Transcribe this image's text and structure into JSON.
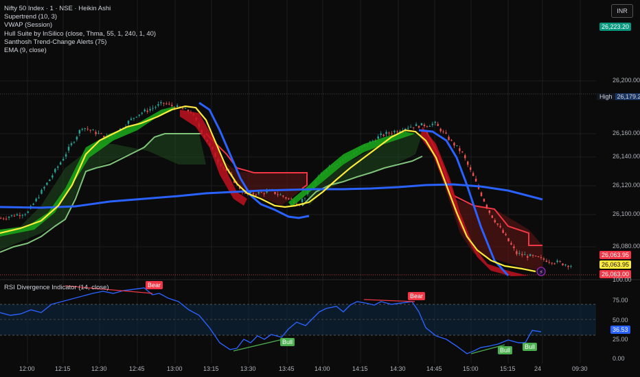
{
  "legend": {
    "symbol": "Nifty 50 Index · 1 · NSE · Heikin Ashi",
    "ind1": "Supertrend (10, 3)",
    "ind2": "VWAP (Session)",
    "ind3": "Hull Suite by InSilico (close, Thma, 55, 1, 240, 1, 40)",
    "ind4": "Santhosh Trend-Change Alerts (75)",
    "ind5": "EMA (9, close)"
  },
  "currency": "INR",
  "price_axis": {
    "ticks": [
      "26,200.00",
      "26,160.00",
      "26,140.00",
      "26,120.00",
      "26,100.00",
      "26,080.00"
    ],
    "high_label": "High",
    "high_value": "26,179.20",
    "top_tag": "26,223.20",
    "tags": [
      "26,063.95",
      "26,063.95",
      "26,063.00"
    ]
  },
  "rsi": {
    "label": "RSI Divergence Indicator (14, close)",
    "ticks": [
      "100.00",
      "75.00",
      "50.00",
      "25.00",
      "0.00"
    ],
    "current": "36.53",
    "signals": [
      "Bear",
      "Bear",
      "Bull",
      "Bull",
      "Bull"
    ]
  },
  "time_axis": [
    "12:00",
    "12:15",
    "12:30",
    "12:45",
    "13:00",
    "13:15",
    "13:30",
    "13:45",
    "14:00",
    "14:15",
    "14:30",
    "14:45",
    "15:00",
    "15:15",
    "24",
    "09:30"
  ],
  "colors": {
    "background": "#0b0b0b",
    "bull": "#26a69a",
    "bear": "#ef5350",
    "vwap": "#2962ff",
    "ema": "#ffeb3b",
    "supertrend_up": "#4caf50",
    "supertrend_down": "#f23645",
    "rsi": "#2962ff"
  },
  "chart_data": {
    "type": "candlestick",
    "x_range": [
      "11:55",
      "15:30"
    ],
    "y_range": [
      26058,
      26230
    ],
    "approx_close_path": [
      {
        "t": "11:55",
        "v": 26096
      },
      {
        "t": "12:05",
        "v": 26100
      },
      {
        "t": "12:15",
        "v": 26128
      },
      {
        "t": "12:25",
        "v": 26158
      },
      {
        "t": "12:35",
        "v": 26150
      },
      {
        "t": "12:45",
        "v": 26166
      },
      {
        "t": "12:55",
        "v": 26174
      },
      {
        "t": "13:05",
        "v": 26168
      },
      {
        "t": "13:15",
        "v": 26135
      },
      {
        "t": "13:25",
        "v": 26112
      },
      {
        "t": "13:35",
        "v": 26114
      },
      {
        "t": "13:45",
        "v": 26106
      },
      {
        "t": "13:55",
        "v": 26130
      },
      {
        "t": "14:05",
        "v": 26140
      },
      {
        "t": "14:15",
        "v": 26152
      },
      {
        "t": "14:25",
        "v": 26158
      },
      {
        "t": "14:35",
        "v": 26160
      },
      {
        "t": "14:45",
        "v": 26140
      },
      {
        "t": "14:55",
        "v": 26100
      },
      {
        "t": "15:05",
        "v": 26072
      },
      {
        "t": "15:15",
        "v": 26068
      },
      {
        "t": "15:25",
        "v": 26064
      }
    ],
    "vwap_path": [
      {
        "t": "11:55",
        "v": 26112
      },
      {
        "t": "12:30",
        "v": 26112
      },
      {
        "t": "13:15",
        "v": 26118
      },
      {
        "t": "14:00",
        "v": 26118
      },
      {
        "t": "14:45",
        "v": 26121
      },
      {
        "t": "15:30",
        "v": 26113
      }
    ],
    "rsi_path": [
      {
        "t": "11:55",
        "v": 60
      },
      {
        "t": "12:15",
        "v": 68
      },
      {
        "t": "12:30",
        "v": 89
      },
      {
        "t": "12:45",
        "v": 88
      },
      {
        "t": "12:55",
        "v": 92
      },
      {
        "t": "13:05",
        "v": 70
      },
      {
        "t": "13:20",
        "v": 30
      },
      {
        "t": "13:35",
        "v": 35
      },
      {
        "t": "13:45",
        "v": 33
      },
      {
        "t": "14:00",
        "v": 65
      },
      {
        "t": "14:15",
        "v": 78
      },
      {
        "t": "14:35",
        "v": 80
      },
      {
        "t": "14:45",
        "v": 40
      },
      {
        "t": "15:00",
        "v": 10
      },
      {
        "t": "15:10",
        "v": 18
      },
      {
        "t": "15:20",
        "v": 36.53
      }
    ]
  }
}
